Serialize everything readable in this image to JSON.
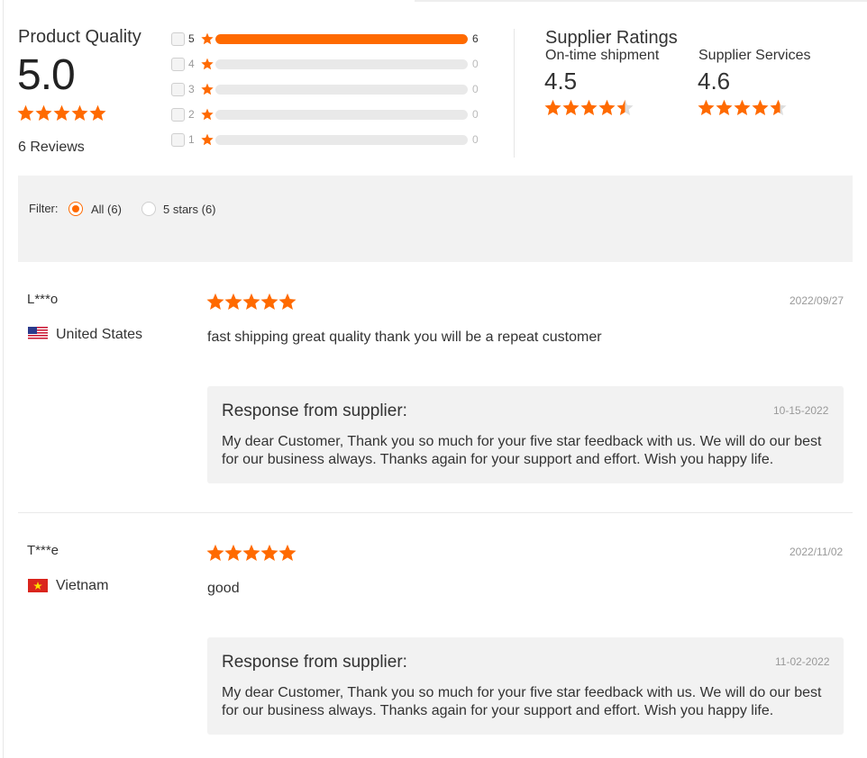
{
  "colors": {
    "accent": "#ff6a00",
    "track": "#e9e9e9",
    "panel": "#f2f2f2"
  },
  "product_quality": {
    "title": "Product Quality",
    "score": "5.0",
    "reviews_label": "6 Reviews",
    "rating_stars": 5,
    "distribution": [
      {
        "stars": "5",
        "count": "6",
        "fraction": 1.0
      },
      {
        "stars": "4",
        "count": "0",
        "fraction": 0
      },
      {
        "stars": "3",
        "count": "0",
        "fraction": 0
      },
      {
        "stars": "2",
        "count": "0",
        "fraction": 0
      },
      {
        "stars": "1",
        "count": "0",
        "fraction": 0
      }
    ]
  },
  "supplier_ratings": {
    "title": "Supplier Ratings",
    "items": [
      {
        "label": "On-time shipment",
        "value": "4.5",
        "stars": 4.5
      },
      {
        "label": "Supplier Services",
        "value": "4.6",
        "stars": 4.6
      }
    ]
  },
  "filter": {
    "label": "Filter:",
    "options": [
      {
        "label": "All (6)",
        "selected": true
      },
      {
        "label": "5 stars (6)",
        "selected": false
      }
    ]
  },
  "reviews": [
    {
      "reviewer": "L***o",
      "country": "United States",
      "flag": "us-flag-icon",
      "stars": 5,
      "date": "2022/09/27",
      "text": "fast shipping great quality thank you will be a repeat customer",
      "response": {
        "title": "Response from supplier:",
        "date": "10-15-2022",
        "text": "My dear Customer, Thank you so much for your five star feedback with us. We will do our best for our business always. Thanks again for your support and effort. Wish you happy life."
      }
    },
    {
      "reviewer": "T***e",
      "country": "Vietnam",
      "flag": "vn-flag-icon",
      "stars": 5,
      "date": "2022/11/02",
      "text": "good",
      "response": {
        "title": "Response from supplier:",
        "date": "11-02-2022",
        "text": "My dear Customer, Thank you so much for your five star feedback with us. We will do our best for our business always. Thanks again for your support and effort. Wish you happy life."
      }
    }
  ]
}
